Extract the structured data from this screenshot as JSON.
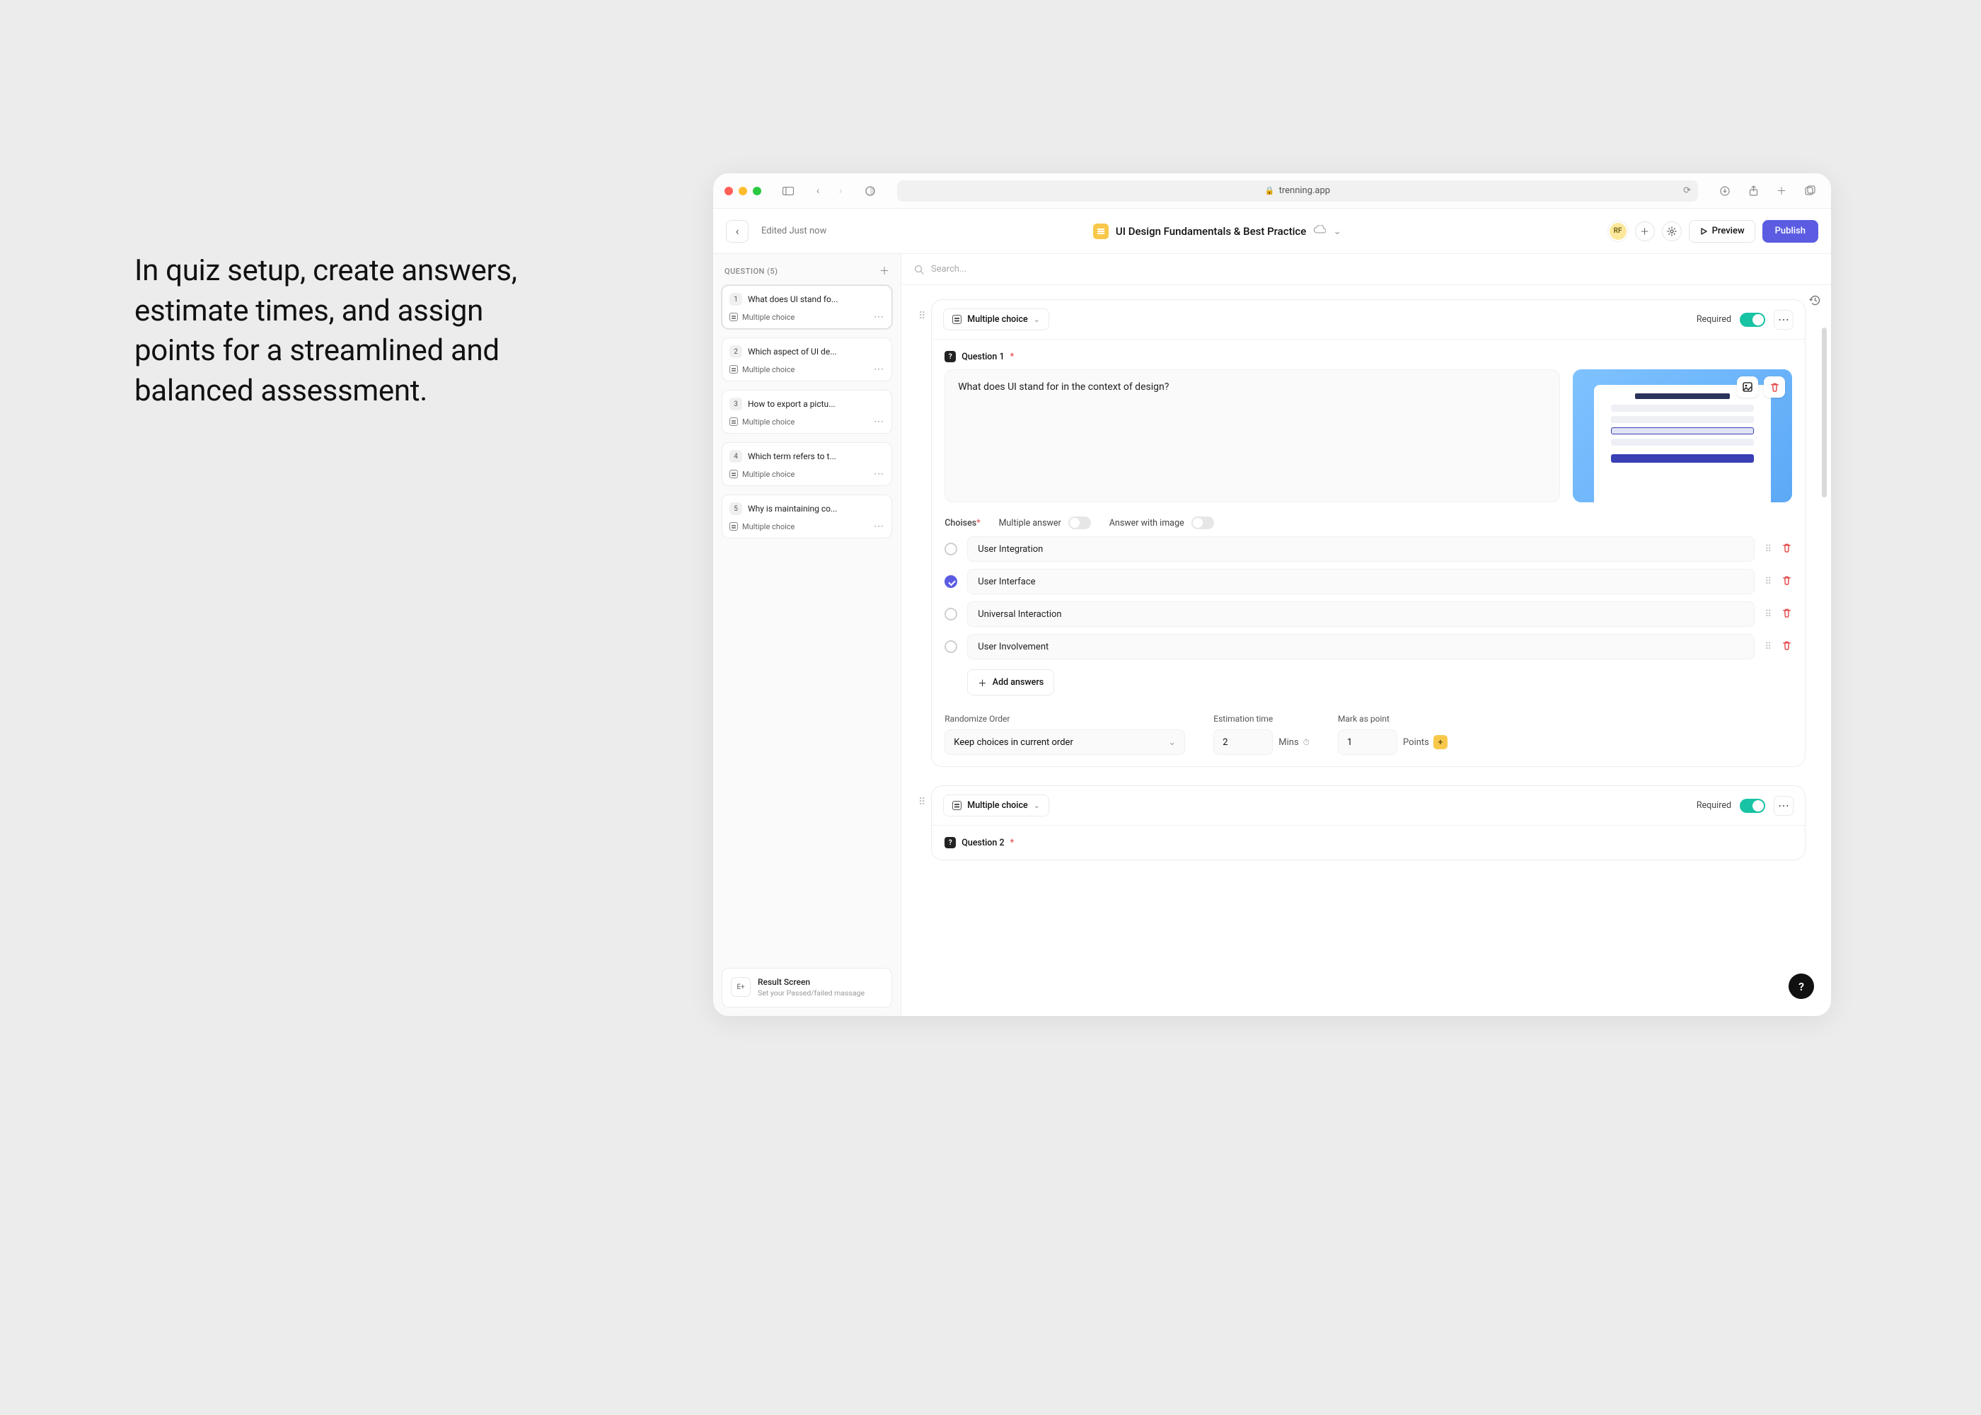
{
  "marketing_blurb": "In quiz setup, create answers, estimate times, and assign points for a streamlined and balanced assessment.",
  "browser": {
    "url_host": "trenning.app"
  },
  "header": {
    "edited_label": "Edited Just now",
    "doc_title": "UI Design Fundamentals & Best Practice",
    "avatar_initials": "RF",
    "preview_label": "Preview",
    "publish_label": "Publish"
  },
  "sidebar": {
    "section_label": "QUESTION (5)",
    "questions": [
      {
        "num": "1",
        "title": "What does UI stand fo...",
        "type": "Multiple choice"
      },
      {
        "num": "2",
        "title": "Which aspect of UI de...",
        "type": "Multiple choice"
      },
      {
        "num": "3",
        "title": "How to export a pictu...",
        "type": "Multiple choice"
      },
      {
        "num": "4",
        "title": "Which term refers to t...",
        "type": "Multiple choice"
      },
      {
        "num": "5",
        "title": "Why is maintaining co...",
        "type": "Multiple choice"
      }
    ],
    "result": {
      "icon_text": "E+",
      "title": "Result Screen",
      "subtitle": "Set your Passed/failed massage"
    }
  },
  "main": {
    "search_placeholder": "Search...",
    "blocks": [
      {
        "type_label": "Multiple choice",
        "required_label": "Required",
        "question_label": "Question 1",
        "question_text": "What does UI stand for in the context of design?",
        "choices_label": "Choises",
        "multi_answer_label": "Multiple answer",
        "answer_image_label": "Answer with image",
        "choices": [
          {
            "text": "User Integration",
            "correct": false
          },
          {
            "text": "User Interface",
            "correct": true
          },
          {
            "text": "Universal Interaction",
            "correct": false
          },
          {
            "text": "User Involvement",
            "correct": false
          }
        ],
        "add_answers_label": "Add answers",
        "randomize_label": "Randomize Order",
        "randomize_value": "Keep choices in current order",
        "est_label": "Estimation time",
        "est_value": "2",
        "est_unit": "Mins",
        "mark_label": "Mark as point",
        "mark_value": "1",
        "mark_unit": "Points"
      },
      {
        "type_label": "Multiple choice",
        "required_label": "Required",
        "question_label": "Question 2"
      }
    ]
  },
  "fab_label": "?"
}
